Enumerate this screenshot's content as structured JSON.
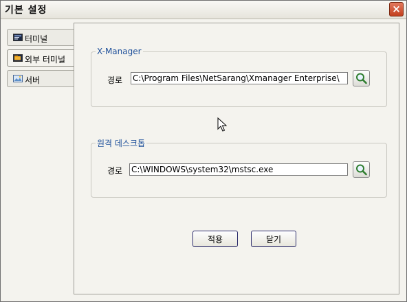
{
  "window": {
    "title": "기본 설정",
    "close_glyph": "×"
  },
  "tabs": [
    {
      "label": "터미널",
      "icon": "terminal-icon"
    },
    {
      "label": "외부 터미널",
      "icon": "external-terminal-icon"
    },
    {
      "label": "서버",
      "icon": "server-icon"
    }
  ],
  "xmanager": {
    "legend": "X-Manager",
    "path_label": "경로",
    "path_value": "C:\\Program Files\\NetSarang\\Xmanager Enterprise\\"
  },
  "remote_desktop": {
    "legend": "원격 데스크톱",
    "path_label": "경로",
    "path_value": "C:\\WINDOWS\\system32\\mstsc.exe"
  },
  "buttons": {
    "apply": "적용",
    "close": "닫기"
  },
  "colors": {
    "accent": "#1d4f9a",
    "close_button": "#c2401f"
  }
}
